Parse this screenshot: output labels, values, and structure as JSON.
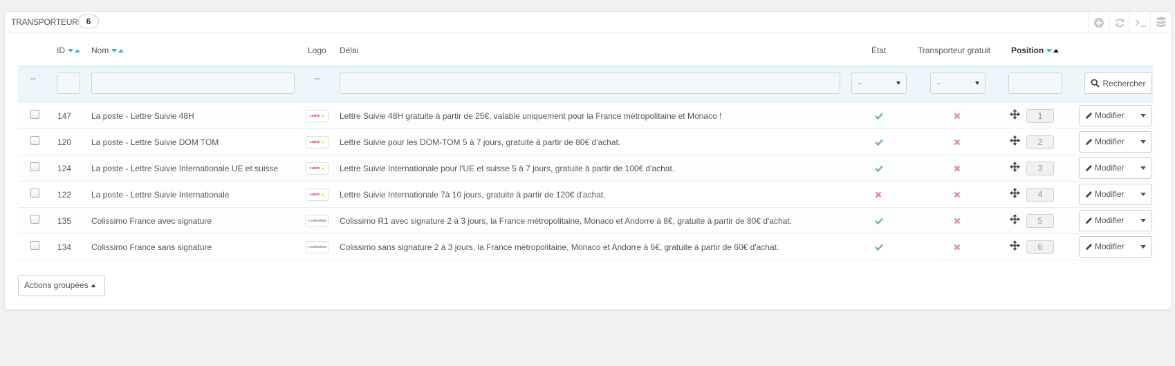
{
  "panel": {
    "title": "Transporteurs",
    "count": "6"
  },
  "toolbar": [
    "add-icon",
    "refresh-icon",
    "terminal-icon",
    "database-icon"
  ],
  "columns": {
    "id": "ID",
    "nom": "Nom",
    "logo": "Logo",
    "delai": "Délai",
    "etat": "État",
    "gratuit": "Transporteur gratuit",
    "position": "Position"
  },
  "filters": {
    "checkbox_dash": "--",
    "logo_dash": "--",
    "etat_value": "-",
    "gratuit_value": "-",
    "search_label": "Rechercher"
  },
  "rows": [
    {
      "id": "147",
      "nom": "La poste - Lettre Suivie 48H",
      "logo": "la-poste",
      "delai": "Lettre Suivie 48H gratuite à partir de 25€, valable uniquement pour la France métropolitaine et Monaco !",
      "etat": true,
      "gratuit": false,
      "position": "1",
      "action": "Modifier"
    },
    {
      "id": "120",
      "nom": "La poste - Lettre Suivie DOM TOM",
      "logo": "la-poste",
      "delai": "Lettre Suivie pour les DOM-TOM 5 à 7 jours, gratuite à partir de 80€ d'achat.",
      "etat": true,
      "gratuit": false,
      "position": "2",
      "action": "Modifier"
    },
    {
      "id": "124",
      "nom": "La poste - Lettre Suivie Internationale UE et suisse",
      "logo": "la-poste",
      "delai": "Lettre Suivie Internationale pour l'UE et suisse 5 à 7 jours, gratuite à partir de 100€ d'achat.",
      "etat": true,
      "gratuit": false,
      "position": "3",
      "action": "Modifier"
    },
    {
      "id": "122",
      "nom": "La poste - Lettre Suivie Internationale",
      "logo": "la-poste",
      "delai": "Lettre Suivie Internationale 7à 10 jours, gratuite à partir de 120€ d'achat.",
      "etat": false,
      "gratuit": false,
      "position": "4",
      "action": "Modifier"
    },
    {
      "id": "135",
      "nom": "Colissimo France avec signature",
      "logo": "colissimo",
      "delai": "Colissimo R1 avec signature 2 à 3 jours, la France métropolitaine, Monaco et Andorre à 8€, gratuite à partir de 80€ d'achat.",
      "etat": true,
      "gratuit": false,
      "position": "5",
      "action": "Modifier"
    },
    {
      "id": "134",
      "nom": "Colissimo France sans signature",
      "logo": "colissimo",
      "delai": "Colissimo sans signature 2 à 3 jours, la France métropolitaine, Monaco et Andorre à 6€, gratuite à partir de 60€ d'achat.",
      "etat": true,
      "gratuit": false,
      "position": "6",
      "action": "Modifier"
    }
  ],
  "bulk_actions": "Actions groupées",
  "colors": {
    "check": "#72c279",
    "cross": "#e08f95",
    "accent": "#25b9d7",
    "filter_bg": "#ecf6fb"
  }
}
